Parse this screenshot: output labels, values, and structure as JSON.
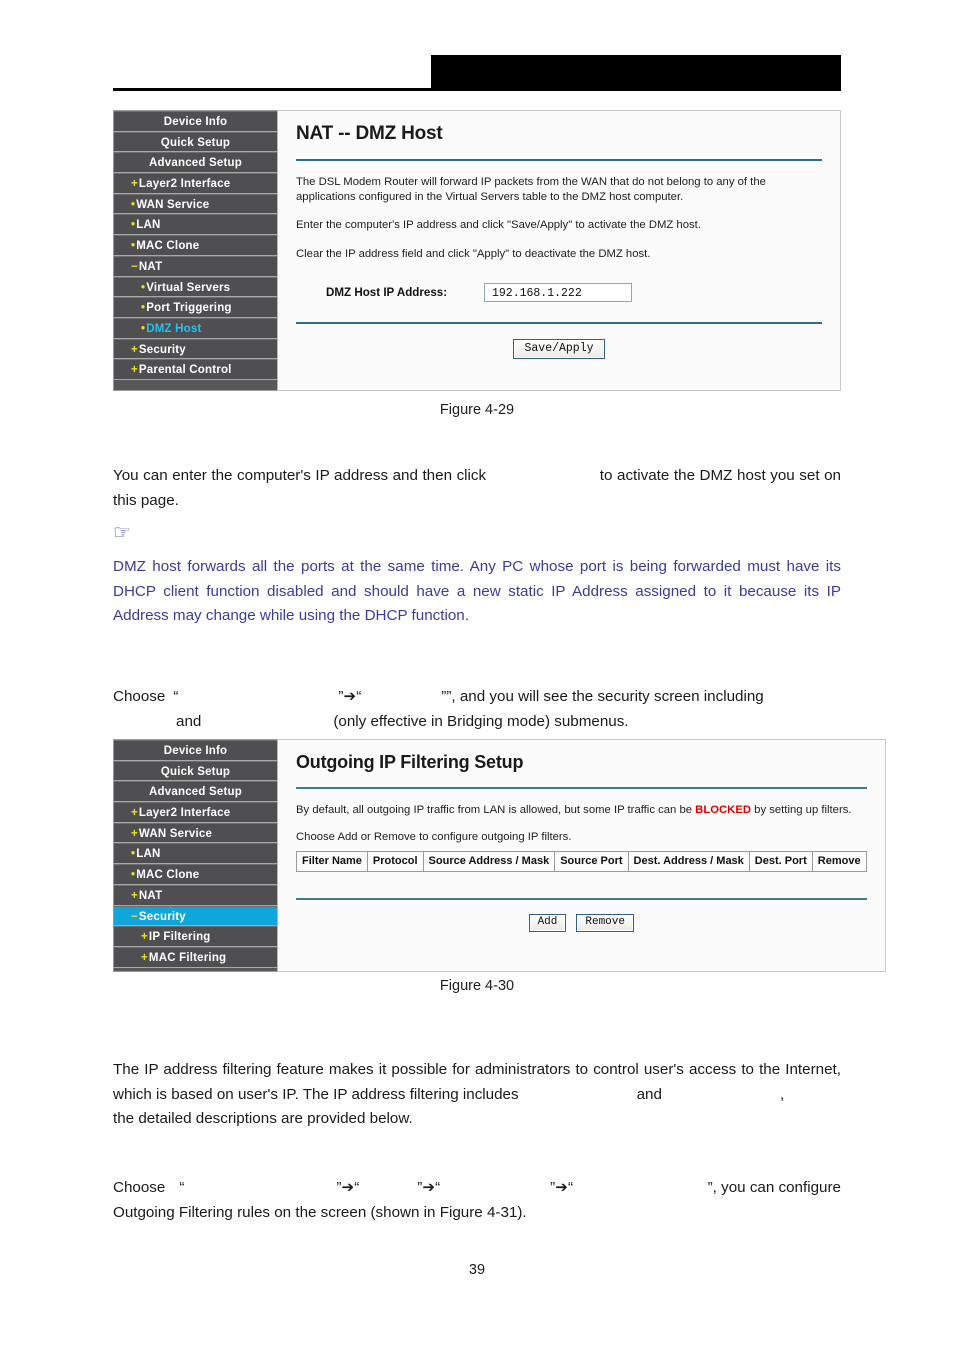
{
  "header": {
    "redaction_bar": true,
    "redaction_color": "#000000"
  },
  "colors": {
    "sidebar_bg": "#4f4f51",
    "sidebar_header_bg": "#58585a",
    "sidebar_text": "#ffffff",
    "marker_yellow": "#f2e01c",
    "active_text_cyan": "#29c0f0",
    "active_bg_cyan": "#0fa6dc",
    "rule_blue": "#2f6c8f",
    "blocked_red": "#e10000",
    "note_blue": "#3b3b9e"
  },
  "figure1": {
    "caption": "Figure 4-29",
    "sidebar": [
      {
        "label": "Device Info",
        "level": 0,
        "marker": "",
        "state": "normal"
      },
      {
        "label": "Quick Setup",
        "level": 0,
        "marker": "",
        "state": "normal"
      },
      {
        "label": "Advanced Setup",
        "level": 0,
        "marker": "",
        "state": "normal"
      },
      {
        "label": "Layer2 Interface",
        "level": 1,
        "marker": "+",
        "state": "normal"
      },
      {
        "label": "WAN Service",
        "level": 1,
        "marker": "•",
        "state": "normal"
      },
      {
        "label": "LAN",
        "level": 1,
        "marker": "•",
        "state": "normal"
      },
      {
        "label": "MAC Clone",
        "level": 1,
        "marker": "•",
        "state": "normal"
      },
      {
        "label": "NAT",
        "level": 1,
        "marker": "−",
        "state": "normal"
      },
      {
        "label": "Virtual Servers",
        "level": 2,
        "marker": "•",
        "state": "normal"
      },
      {
        "label": "Port Triggering",
        "level": 2,
        "marker": "•",
        "state": "normal"
      },
      {
        "label": "DMZ Host",
        "level": 2,
        "marker": "•",
        "state": "selected-text"
      },
      {
        "label": "Security",
        "level": 1,
        "marker": "+",
        "state": "normal"
      },
      {
        "label": "Parental Control",
        "level": 1,
        "marker": "+",
        "state": "normal"
      }
    ],
    "panel": {
      "title": "NAT -- DMZ Host",
      "paragraph1": "The DSL Modem Router will forward IP packets from the WAN that do not belong to any of the applications configured in the Virtual Servers table to the DMZ host computer.",
      "paragraph2": "Enter the computer's IP address and click \"Save/Apply\" to activate the DMZ host.",
      "paragraph3": "Clear the IP address field and click \"Apply\" to deactivate the DMZ host.",
      "field_label": "DMZ Host IP Address:",
      "field_value": "192.168.1.222",
      "button_label": "Save/Apply"
    }
  },
  "figure2": {
    "caption": "Figure 4-30",
    "sidebar": [
      {
        "label": "Device Info",
        "level": 0,
        "marker": "",
        "state": "normal"
      },
      {
        "label": "Quick Setup",
        "level": 0,
        "marker": "",
        "state": "normal"
      },
      {
        "label": "Advanced Setup",
        "level": 0,
        "marker": "",
        "state": "normal"
      },
      {
        "label": "Layer2 Interface",
        "level": 1,
        "marker": "+",
        "state": "normal"
      },
      {
        "label": "WAN Service",
        "level": 1,
        "marker": "+",
        "state": "normal"
      },
      {
        "label": "LAN",
        "level": 1,
        "marker": "•",
        "state": "normal"
      },
      {
        "label": "MAC Clone",
        "level": 1,
        "marker": "•",
        "state": "normal"
      },
      {
        "label": "NAT",
        "level": 1,
        "marker": "+",
        "state": "normal"
      },
      {
        "label": "Security",
        "level": 1,
        "marker": "−",
        "state": "selected-bg"
      },
      {
        "label": "IP Filtering",
        "level": 2,
        "marker": "+",
        "state": "normal"
      },
      {
        "label": "MAC Filtering",
        "level": 2,
        "marker": "+",
        "state": "normal"
      }
    ],
    "panel": {
      "title": "Outgoing IP Filtering Setup",
      "paragraph1_before": "By default, all outgoing IP traffic from LAN is allowed, but some IP traffic can be ",
      "paragraph1_blocked": "BLOCKED",
      "paragraph1_after": " by setting up filters.",
      "paragraph2": "Choose Add or Remove to configure outgoing IP filters.",
      "table_headers": [
        "Filter Name",
        "Protocol",
        "Source Address / Mask",
        "Source Port",
        "Dest. Address / Mask",
        "Dest. Port",
        "Remove"
      ],
      "table_rows": [],
      "button_add": "Add",
      "button_remove": "Remove"
    }
  },
  "body": {
    "para1_a": "You can enter the computer's IP address and then click ",
    "para1_blank": "                        ",
    "para1_b": "to activate the DMZ host you set on this page.",
    "note_icon": "☞",
    "note": "DMZ host forwards all the ports at the same time. Any PC whose port is being forwarded must have its DHCP client function disabled and should have a new static IP Address assigned to it because its IP Address may change while using the DHCP function.",
    "para2_choose": "Choose",
    "para2_q1": "”",
    "para2_arrow": "➔",
    "para2_q2": "“",
    "para2_rest": "”,  and  you  will  see  the  security  screen  including",
    "para2_line2_and": "and",
    "para2_line2_rest": "(only effective in Bridging mode) submenus.",
    "para3": "The IP address filtering feature makes it possible for administrators to control user's access to the Internet, which is based on user's IP. The IP address filtering includes",
    "para3_and": "and",
    "para3_tail": ",",
    "para3_line3": "the detailed descriptions are provided below.",
    "para4_choose": "Choose",
    "para4_rest": "”,  you  can  configure",
    "para4_line2": "Outgoing Filtering rules on the screen (shown in Figure 4-31)."
  },
  "footer": {
    "page_number": "39"
  }
}
